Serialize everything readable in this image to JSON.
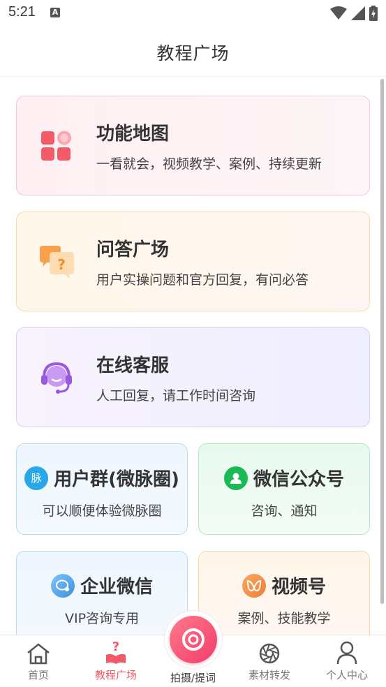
{
  "status_bar": {
    "time": "5:21",
    "notification_letter": "A"
  },
  "header": {
    "title": "教程广场"
  },
  "cards": {
    "map": {
      "title": "功能地图",
      "desc": "一看就会，视频教学、案例、持续更新",
      "icon": "grid-icon"
    },
    "qa": {
      "title": "问答广场",
      "desc": "用户实操问题和官方回复，有问必答",
      "icon": "chat-question-icon"
    },
    "service": {
      "title": "在线客服",
      "desc": "人工回复，请工作时间咨询",
      "icon": "headset-icon"
    },
    "group": {
      "title": "用户群(微脉圈)",
      "desc": "可以顺便体验微脉圈",
      "badge": "脉",
      "icon": "maiquan-icon"
    },
    "wechat": {
      "title": "微信公众号",
      "desc": "咨询、通知",
      "icon": "wechat-official-icon"
    },
    "work": {
      "title": "企业微信",
      "desc": "VIP咨询专用",
      "icon": "work-wechat-icon"
    },
    "video": {
      "title": "视频号",
      "desc": "案例、技能教学",
      "icon": "video-channel-icon"
    }
  },
  "bottom_nav": {
    "home": "首页",
    "tutorial": "教程广场",
    "capture": "拍摄/提词",
    "material": "素材转发",
    "profile": "个人中心",
    "active": "tutorial"
  },
  "colors": {
    "accent": "#f15a68",
    "capture_start": "#ff7a8a",
    "capture_end": "#f23c6d"
  }
}
